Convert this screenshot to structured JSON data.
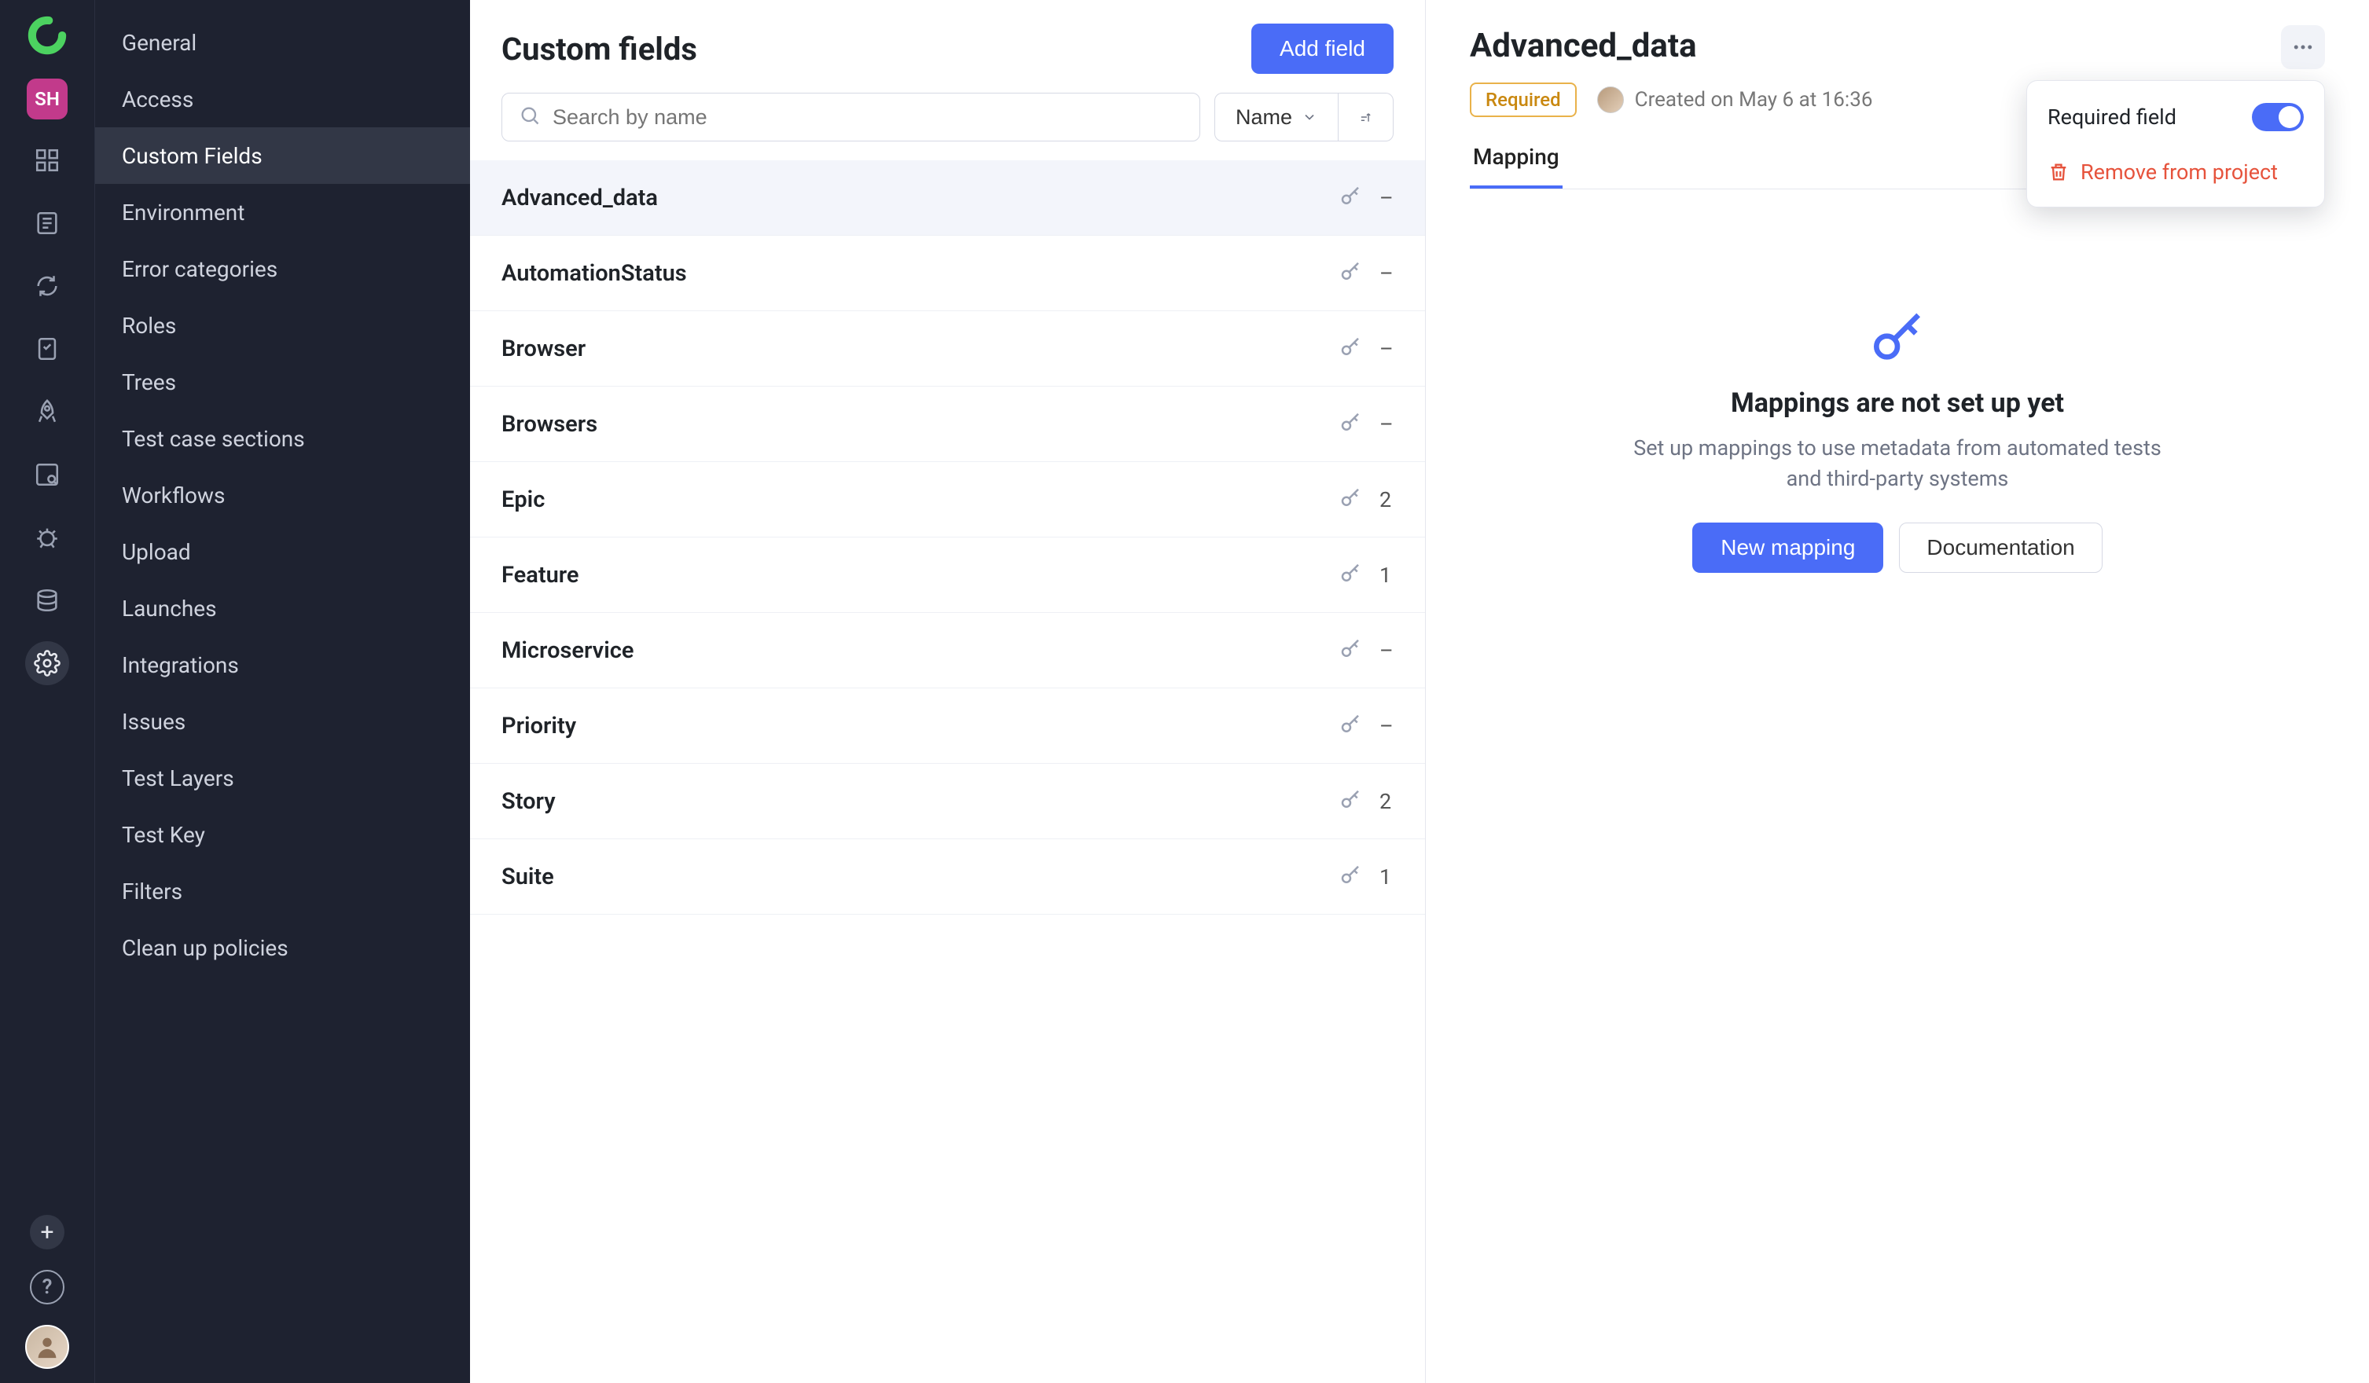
{
  "rail": {
    "workspace_initials": "SH",
    "icons": [
      "dashboard",
      "results",
      "cycles",
      "testplans",
      "launches-rocket",
      "analytics",
      "defects",
      "environments",
      "settings"
    ]
  },
  "settings_nav": {
    "items": [
      {
        "label": "General",
        "key": "general",
        "active": false
      },
      {
        "label": "Access",
        "key": "access",
        "active": false
      },
      {
        "label": "Custom Fields",
        "key": "custom-fields",
        "active": true
      },
      {
        "label": "Environment",
        "key": "environment",
        "active": false
      },
      {
        "label": "Error categories",
        "key": "error-categories",
        "active": false
      },
      {
        "label": "Roles",
        "key": "roles",
        "active": false
      },
      {
        "label": "Trees",
        "key": "trees",
        "active": false
      },
      {
        "label": "Test case sections",
        "key": "tc-sections",
        "active": false
      },
      {
        "label": "Workflows",
        "key": "workflows",
        "active": false
      },
      {
        "label": "Upload",
        "key": "upload",
        "active": false
      },
      {
        "label": "Launches",
        "key": "launches",
        "active": false
      },
      {
        "label": "Integrations",
        "key": "integrations",
        "active": false
      },
      {
        "label": "Issues",
        "key": "issues",
        "active": false
      },
      {
        "label": "Test Layers",
        "key": "test-layers",
        "active": false
      },
      {
        "label": "Test Key",
        "key": "test-key",
        "active": false
      },
      {
        "label": "Filters",
        "key": "filters",
        "active": false
      },
      {
        "label": "Clean up policies",
        "key": "cleanup",
        "active": false
      }
    ]
  },
  "main": {
    "title": "Custom fields",
    "add_button": "Add field",
    "search_placeholder": "Search by name",
    "sort_label": "Name",
    "fields": [
      {
        "name": "Advanced_data",
        "count": "–",
        "selected": true
      },
      {
        "name": "AutomationStatus",
        "count": "–",
        "selected": false
      },
      {
        "name": "Browser",
        "count": "–",
        "selected": false
      },
      {
        "name": "Browsers",
        "count": "–",
        "selected": false
      },
      {
        "name": "Epic",
        "count": "2",
        "selected": false
      },
      {
        "name": "Feature",
        "count": "1",
        "selected": false
      },
      {
        "name": "Microservice",
        "count": "–",
        "selected": false
      },
      {
        "name": "Priority",
        "count": "–",
        "selected": false
      },
      {
        "name": "Story",
        "count": "2",
        "selected": false
      },
      {
        "name": "Suite",
        "count": "1",
        "selected": false
      }
    ]
  },
  "detail": {
    "title": "Advanced_data",
    "required_badge": "Required",
    "created_text": "Created on May 6 at 16:36",
    "tab_mapping": "Mapping",
    "empty_title": "Mappings are not set up yet",
    "empty_sub1": "Set up mappings to use metadata from automated tests",
    "empty_sub2": "and third-party systems",
    "btn_new_mapping": "New mapping",
    "btn_docs": "Documentation"
  },
  "popover": {
    "required_label": "Required field",
    "required_on": true,
    "remove_label": "Remove from project"
  }
}
